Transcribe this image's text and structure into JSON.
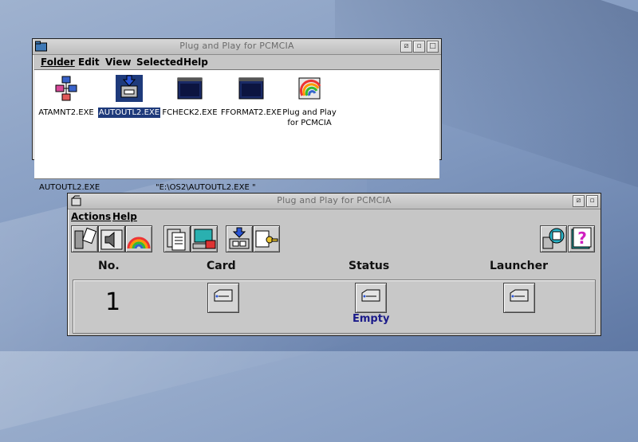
{
  "window1": {
    "title": "Plug and Play for PCMCIA",
    "menu": [
      "Folder",
      "Edit",
      "View",
      "Selected",
      "Help"
    ],
    "icons": [
      {
        "label": "ATAMNT2.EXE",
        "icon": "network-blocks-icon",
        "selected": false
      },
      {
        "label": "AUTOUTL2.EXE",
        "icon": "download-card-icon",
        "selected": true
      },
      {
        "label": "FCHECK2.EXE",
        "icon": "terminal-window-icon",
        "selected": false
      },
      {
        "label": "FFORMAT2.EXE",
        "icon": "terminal-window-icon",
        "selected": false
      },
      {
        "label": "Plug and Play\nfor PCMCIA",
        "icon": "rainbow-folder-icon",
        "selected": false
      }
    ],
    "status_left": "AUTOUTL2.EXE",
    "status_right": "\"E:\\OS2\\AUTOUTL2.EXE \""
  },
  "window2": {
    "title": "Plug and Play for PCMCIA",
    "menu": [
      "Actions",
      "Help"
    ],
    "columns": {
      "no": "No.",
      "card": "Card",
      "status": "Status",
      "launcher": "Launcher"
    },
    "slot": {
      "number": "1",
      "status": "Empty"
    }
  },
  "colors": {
    "selection": "#1e3a7b",
    "status_text": "#1b1b8a"
  }
}
